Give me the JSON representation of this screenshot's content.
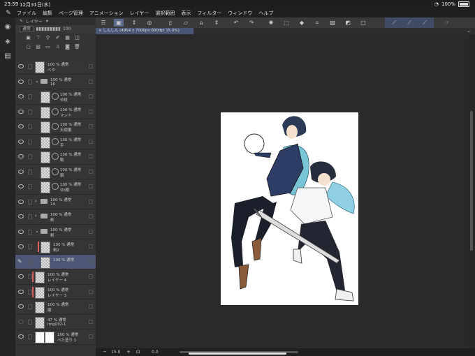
{
  "status_bar": {
    "time": "23:59",
    "date": "12月31日(木)",
    "battery": "100%"
  },
  "menu_bar": {
    "items": [
      "ファイル",
      "編集",
      "ページ管理",
      "アニメーション",
      "レイヤー",
      "選択範囲",
      "表示",
      "フィルター",
      "ウィンドウ",
      "ヘルプ"
    ]
  },
  "layer_panel": {
    "tool_row_label": "レイヤー",
    "blend_mode": "通常",
    "opacity": "100",
    "layers": [
      {
        "line1": "100 % 通常",
        "line2": "ベタ",
        "type": "raster",
        "indent": 0,
        "visible": true
      },
      {
        "line1": "100 % 通常",
        "line2": "16",
        "type": "folder",
        "indent": 0,
        "visible": true,
        "expanded": true
      },
      {
        "line1": "100 % 通常",
        "line2": "ゆ杖",
        "type": "masked",
        "indent": 1,
        "visible": true
      },
      {
        "line1": "100 % 通常",
        "line2": "マント",
        "type": "masked",
        "indent": 1,
        "visible": true
      },
      {
        "line1": "100 % 通常",
        "line2": "天使服",
        "type": "masked",
        "indent": 1,
        "visible": true
      },
      {
        "line1": "100 % 通常",
        "line2": "手",
        "type": "masked",
        "indent": 1,
        "visible": true
      },
      {
        "line1": "100 % 通常",
        "line2": "靴",
        "type": "masked",
        "indent": 1,
        "visible": true
      },
      {
        "line1": "100 % 通常",
        "line2": "服",
        "type": "masked",
        "indent": 1,
        "visible": true
      },
      {
        "line1": "100 % 通常",
        "line2": "ゆ/顔",
        "type": "masked",
        "indent": 1,
        "visible": true
      },
      {
        "line1": "100 % 通常",
        "line2": "14",
        "type": "folder",
        "indent": 0,
        "visible": true,
        "expanded": false
      },
      {
        "line1": "100 % 通常",
        "line2": "剣",
        "type": "folder",
        "indent": 0,
        "visible": true,
        "expanded": false
      },
      {
        "line1": "100 % 通常",
        "line2": "剣",
        "type": "folder",
        "indent": 0,
        "visible": true,
        "expanded": true
      },
      {
        "line1": "100 % 通常",
        "line2": "剣2",
        "type": "raster-red",
        "indent": 1,
        "visible": true
      },
      {
        "line1": "100 % 通常",
        "line2": "",
        "type": "raster",
        "indent": 1,
        "visible": true,
        "selected": true
      },
      {
        "line1": "100 % 通常",
        "line2": "レイヤー 4",
        "type": "raster-red",
        "indent": 0,
        "visible": true
      },
      {
        "line1": "100 % 通常",
        "line2": "レイヤー 3",
        "type": "raster-red",
        "indent": 0,
        "visible": true
      },
      {
        "line1": "100 % 通常",
        "line2": "服",
        "type": "image",
        "indent": 0,
        "visible": true
      },
      {
        "line1": "47 % 通常",
        "line2": "img032-1",
        "type": "raster",
        "indent": 0,
        "visible": false
      },
      {
        "line1": "100 % 通常",
        "line2": "ベた塗り 1",
        "type": "fill",
        "indent": 0,
        "visible": true
      }
    ]
  },
  "canvas_tab": {
    "title": "しんしん (4954 x 7000px 600dpi 15.0%)"
  },
  "bottom_bar": {
    "zoom": "15.0",
    "rotation": "0.0"
  }
}
